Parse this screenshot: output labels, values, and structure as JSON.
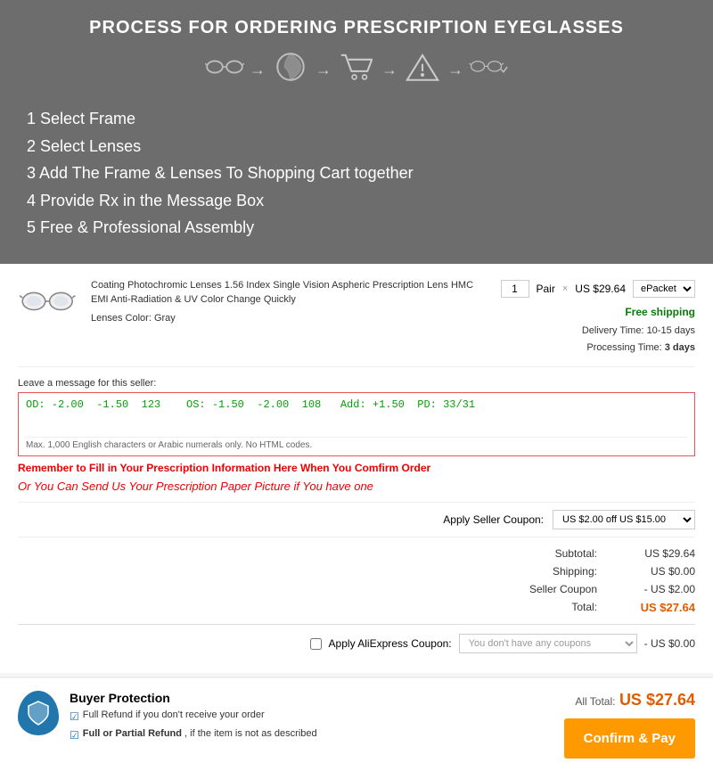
{
  "banner": {
    "title": "PROCESS FOR ORDERING PRESCRIPTION EYEGLASSES",
    "steps": [
      {
        "id": 1,
        "label": "Select Frame"
      },
      {
        "id": 2,
        "label": "Select Lenses"
      },
      {
        "id": 3,
        "label": "Add The Frame & Lenses To Shopping Cart together"
      },
      {
        "id": 4,
        "label": "Provide Rx in the Message Box"
      },
      {
        "id": 5,
        "label": "Free & Professional Assembly"
      }
    ]
  },
  "product": {
    "name": "Coating Photochromic Lenses 1.56 Index Single Vision Aspheric Prescription Lens HMC EMI Anti-Radiation & UV Color Change Quickly",
    "lenses_color_label": "Lenses Color:",
    "lenses_color": "Gray",
    "quantity": "1",
    "quantity_unit": "Pair",
    "price": "US $29.64",
    "shipping_method": "ePacket",
    "free_shipping": "Free shipping",
    "delivery_time_label": "Delivery Time:",
    "delivery_time": "10-15 days",
    "processing_time_label": "Processing Time:",
    "processing_time": "3 days"
  },
  "message": {
    "label": "Leave a message for this seller:",
    "value": "OD: -2.00  -1.50  123    OS: -1.50  -2.00  108   Add: +1.50  PD: 33/31",
    "hint": "Max. 1,000 English characters or Arabic numerals only. No HTML codes.",
    "reminder": "Remember to Fill in Your Prescription Information Here When You Comfirm Order",
    "alt_text": "Or You Can Send Us Your Prescription Paper Picture if You have one"
  },
  "seller_coupon": {
    "label": "Apply Seller Coupon:",
    "value": "US $2.00 off US $15.00"
  },
  "totals": {
    "subtotal_label": "Subtotal:",
    "subtotal": "US $29.64",
    "shipping_label": "Shipping:",
    "shipping": "US $0.00",
    "seller_coupon_label": "Seller Coupon",
    "seller_coupon_value": "- US $2.00",
    "total_label": "Total:",
    "total": "US $27.64"
  },
  "aliexpress_coupon": {
    "label": "Apply AliExpress Coupon:",
    "placeholder": "You don't have any coupons",
    "discount": "- US $0.00"
  },
  "buyer_protection": {
    "title": "Buyer Protection",
    "items": [
      "Full Refund if you don't receive your order",
      "Full or Partial Refund , if the item is not as described"
    ]
  },
  "checkout": {
    "all_total_label": "All Total:",
    "all_total": "US $27.64",
    "confirm_pay_label": "Confirm & Pay"
  }
}
